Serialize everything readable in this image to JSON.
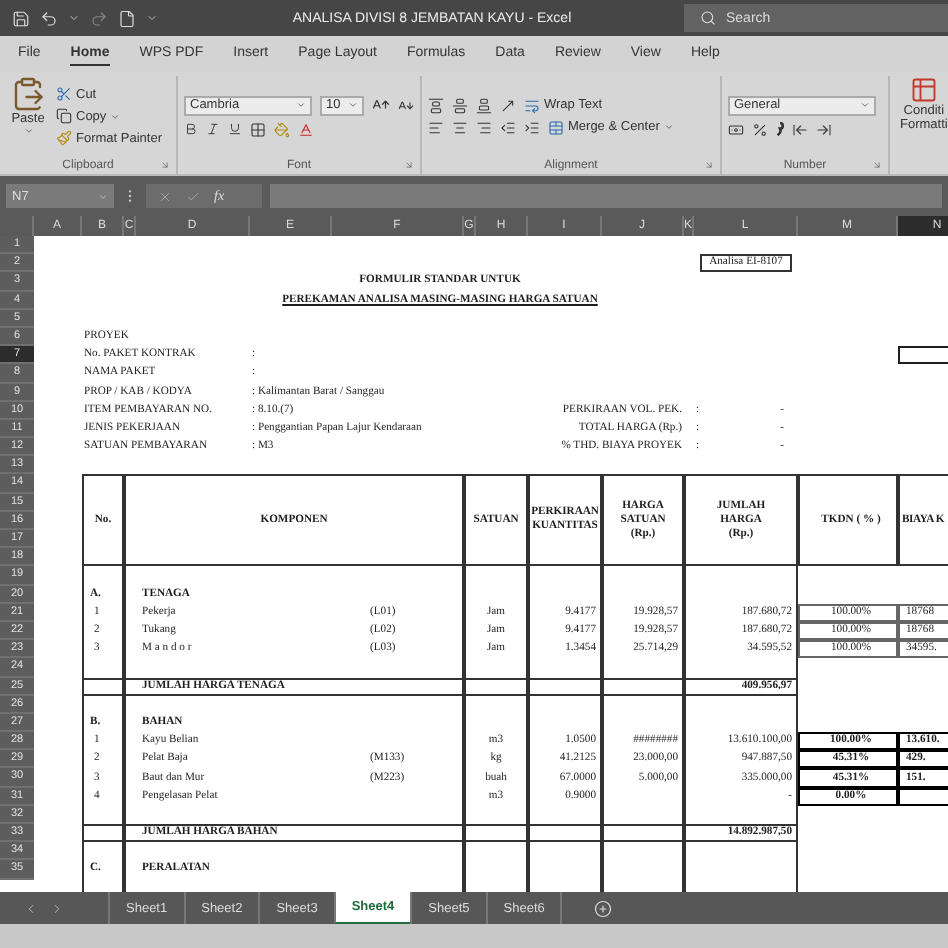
{
  "window": {
    "title": "ANALISA DIVISI 8 JEMBATAN KAYU  -  Excel",
    "search": {
      "placeholder": "Search"
    }
  },
  "menu_tabs": [
    {
      "label": "File",
      "selected": false
    },
    {
      "label": "Home",
      "selected": true
    },
    {
      "label": "WPS PDF",
      "selected": false
    },
    {
      "label": "Insert",
      "selected": false
    },
    {
      "label": "Page Layout",
      "selected": false
    },
    {
      "label": "Formulas",
      "selected": false
    },
    {
      "label": "Data",
      "selected": false
    },
    {
      "label": "Review",
      "selected": false
    },
    {
      "label": "View",
      "selected": false
    },
    {
      "label": "Help",
      "selected": false
    }
  ],
  "ribbon": {
    "clipboard": {
      "paste": "Paste",
      "cut": "Cut",
      "copy": "Copy",
      "format_painter": "Format Painter",
      "label": "Clipboard"
    },
    "font": {
      "family": "Cambria",
      "size": "10",
      "label": "Font"
    },
    "alignment": {
      "wrap_text": "Wrap Text",
      "merge": "Merge & Center",
      "label": "Alignment"
    },
    "number": {
      "format": "General",
      "label": "Number"
    },
    "styles": {
      "conditional_formatting": [
        "Conditi",
        "Formatti"
      ]
    }
  },
  "formula_bar": {
    "name_box": "N7",
    "function_label": "fx"
  },
  "columns": [
    {
      "label": "A",
      "selected": false
    },
    {
      "label": "B",
      "selected": false
    },
    {
      "label": "C",
      "selected": false
    },
    {
      "label": "D",
      "selected": false
    },
    {
      "label": "E",
      "selected": false
    },
    {
      "label": "F",
      "selected": false
    },
    {
      "label": "G",
      "selected": false
    },
    {
      "label": "H",
      "selected": false
    },
    {
      "label": "I",
      "selected": false
    },
    {
      "label": "J",
      "selected": false
    },
    {
      "label": "K",
      "selected": false
    },
    {
      "label": "L",
      "selected": false
    },
    {
      "label": "M",
      "selected": false
    },
    {
      "label": "N",
      "selected": true
    }
  ],
  "rows": [
    {
      "label": "1",
      "selected": false
    },
    {
      "label": "2",
      "selected": false
    },
    {
      "label": "3",
      "selected": false
    },
    {
      "label": "4",
      "selected": false
    },
    {
      "label": "5",
      "selected": false
    },
    {
      "label": "6",
      "selected": false
    },
    {
      "label": "7",
      "selected": true
    },
    {
      "label": "8",
      "selected": false
    },
    {
      "label": "9",
      "selected": false
    },
    {
      "label": "10",
      "selected": false
    },
    {
      "label": "11",
      "selected": false
    },
    {
      "label": "12",
      "selected": false
    },
    {
      "label": "13",
      "selected": false
    },
    {
      "label": "14",
      "selected": false
    },
    {
      "label": "15",
      "selected": false
    },
    {
      "label": "16",
      "selected": false
    },
    {
      "label": "17",
      "selected": false
    },
    {
      "label": "18",
      "selected": false
    },
    {
      "label": "19",
      "selected": false
    },
    {
      "label": "20",
      "selected": false
    },
    {
      "label": "21",
      "selected": false
    },
    {
      "label": "22",
      "selected": false
    },
    {
      "label": "23",
      "selected": false
    },
    {
      "label": "24",
      "selected": false
    },
    {
      "label": "25",
      "selected": false
    },
    {
      "label": "26",
      "selected": false
    },
    {
      "label": "27",
      "selected": false
    },
    {
      "label": "28",
      "selected": false
    },
    {
      "label": "29",
      "selected": false
    },
    {
      "label": "30",
      "selected": false
    },
    {
      "label": "31",
      "selected": false
    },
    {
      "label": "32",
      "selected": false
    },
    {
      "label": "33",
      "selected": false
    },
    {
      "label": "34",
      "selected": false
    },
    {
      "label": "35",
      "selected": false
    }
  ],
  "sheet": {
    "reference": "Analisa EI-8107",
    "title": "FORMULIR STANDAR UNTUK",
    "subtitle": "PEREKAMAN ANALISA MASING-MASING HARGA SATUAN",
    "info": [
      {
        "label": "PROYEK"
      },
      {
        "label": "No. PAKET KONTRAK",
        "value": ":"
      },
      {
        "label": "NAMA PAKET",
        "value": ":"
      },
      {
        "label": "PROP / KAB / KODYA",
        "value": ": Kalimantan Barat / Sanggau"
      },
      {
        "label": "ITEM PEMBAYARAN NO.",
        "value": ": 8.10.(7)"
      },
      {
        "label": "JENIS PEKERJAAN",
        "value": ": Penggantian Papan Lajur Kendaraan"
      },
      {
        "label": "SATUAN PEMBAYARAN",
        "value": ": M3"
      }
    ],
    "summary": [
      {
        "label": "PERKIRAAN VOL. PEK.",
        "separator": ":",
        "value": "-"
      },
      {
        "label": "TOTAL HARGA (Rp.)",
        "separator": ":",
        "value": "-"
      },
      {
        "label": "% THD. BIAYA PROYEK",
        "separator": ":",
        "value": "-"
      }
    ],
    "table": {
      "columns": [
        "No.",
        "KOMPONEN",
        "SATUAN",
        "PERKIRAAN\nKUANTITAS",
        "HARGA\nSATUAN\n(Rp.)",
        "JUMLAH\nHARGA\n(Rp.)",
        "TKDN ( % )",
        "BIAYA K"
      ],
      "sections": [
        {
          "code": "A.",
          "title": "TENAGA",
          "emphasis": false,
          "items": [
            {
              "no": "1",
              "name": "Pekerja",
              "code": "(L01)",
              "unit": "Jam",
              "quantity": "9.4177",
              "price": "19.928,57",
              "total": "187.680,72",
              "tkdn": "100.00%",
              "cost": "18768"
            },
            {
              "no": "2",
              "name": "Tukang",
              "code": "(L02)",
              "unit": "Jam",
              "quantity": "9.4177",
              "price": "19.928,57",
              "total": "187.680,72",
              "tkdn": "100.00%",
              "cost": "18768"
            },
            {
              "no": "3",
              "name": "M a n d o r",
              "code": "(L03)",
              "unit": "Jam",
              "quantity": "1.3454",
              "price": "25.714,29",
              "total": "34.595,52",
              "tkdn": "100.00%",
              "cost": "34595."
            }
          ],
          "total_label": "JUMLAH HARGA TENAGA",
          "total": "409.956,97"
        },
        {
          "code": "B.",
          "title": "BAHAN",
          "emphasis": true,
          "items": [
            {
              "no": "1",
              "name": "Kayu Belian",
              "unit": "m3",
              "quantity": "1.0500",
              "price": "########",
              "total": "13.610.100,00",
              "tkdn": "100.00%",
              "cost": "13.610."
            },
            {
              "no": "2",
              "name": "Pelat Baja",
              "code": "(M133)",
              "unit": "kg",
              "quantity": "41.2125",
              "price": "23.000,00",
              "total": "947.887,50",
              "tkdn": "45.31%",
              "cost": "429."
            },
            {
              "no": "3",
              "name": "Baut dan Mur",
              "code": "(M223)",
              "unit": "buah",
              "quantity": "67.0000",
              "price": "5.000,00",
              "total": "335.000,00",
              "tkdn": "45.31%",
              "cost": "151."
            },
            {
              "no": "4",
              "name": "Pengelasan Pelat",
              "unit": "m3",
              "quantity": "0.9000",
              "total": "-",
              "tkdn": "0.00%"
            }
          ],
          "total_label": "JUMLAH HARGA BAHAN",
          "total": "14.892.987,50"
        },
        {
          "code": "C.",
          "title": "PERALATAN"
        }
      ]
    }
  },
  "sheet_tabs": [
    {
      "label": "Sheet1",
      "selected": false
    },
    {
      "label": "Sheet2",
      "selected": false
    },
    {
      "label": "Sheet3",
      "selected": false
    },
    {
      "label": "Sheet4",
      "selected": true
    },
    {
      "label": "Sheet5",
      "selected": false
    },
    {
      "label": "Sheet6",
      "selected": false
    }
  ]
}
